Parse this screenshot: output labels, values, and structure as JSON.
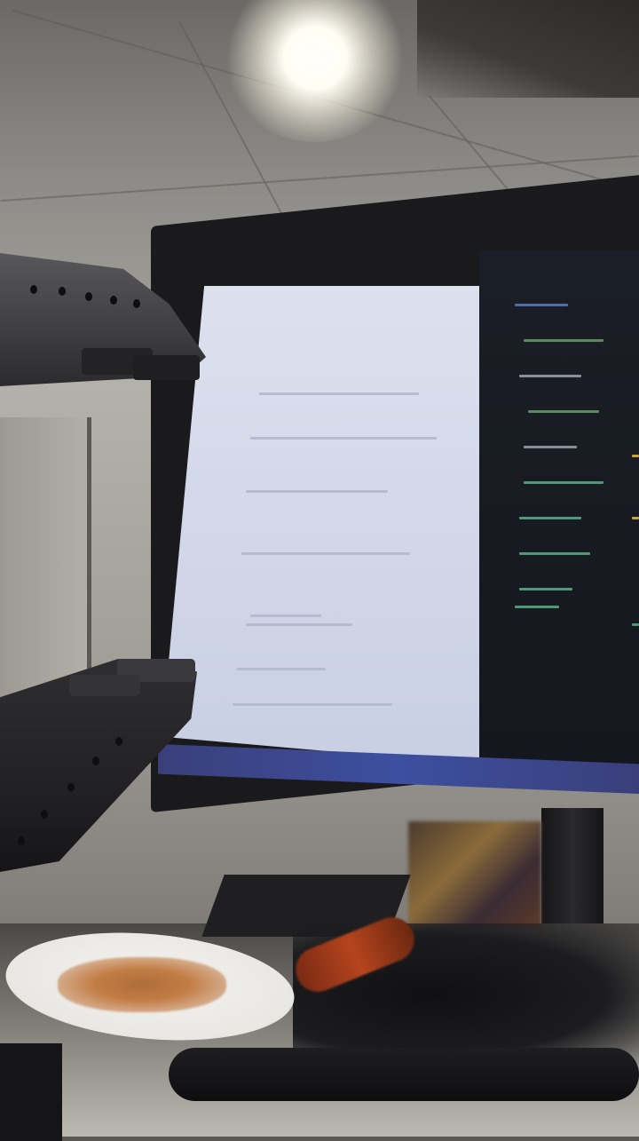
{
  "scene": {
    "kind": "photo",
    "subjects": [
      "robot-gripper",
      "computer-monitor",
      "ceiling-light",
      "plate-with-food",
      "desk",
      "office-chair"
    ]
  },
  "colors": {
    "ceiling": "#8c8a86",
    "screen_light": "#d4d9ea",
    "screen_dark": "#14171d",
    "taskbar": "#3d4fa0",
    "gripper": "#3e3d40",
    "plate": "#f4f3ef",
    "food": "#c27c45"
  }
}
